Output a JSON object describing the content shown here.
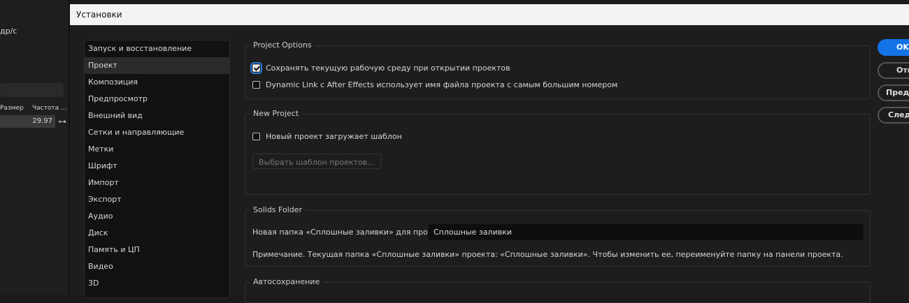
{
  "background_panel": {
    "fps_label": "дp/с",
    "columns": [
      "Размер",
      "Частота ..."
    ],
    "row_value": "29.97"
  },
  "dialog": {
    "title": "Установки",
    "sidebar": [
      "Запуск и восстановление",
      "Проект",
      "Композиция",
      "Предпросмотр",
      "Внешний вид",
      "Сетки и направляющие",
      "Метки",
      "Шрифт",
      "Импорт",
      "Экспорт",
      "Аудио",
      "Диск",
      "Память и ЦП",
      "Видео",
      "3D"
    ],
    "selected": "Проект",
    "project_options": {
      "title": "Project Options",
      "opt1": "Сохранять текущую рабочую среду при открытии проектов",
      "opt1_checked": true,
      "opt2": "Dynamic Link с After Effects использует имя файла проекта с самым большим номером",
      "opt2_checked": false
    },
    "new_project": {
      "title": "New Project",
      "opt": "Новый проект загружает шаблон",
      "opt_checked": false,
      "choose_button": "Выбрать шаблон проектов..."
    },
    "solids": {
      "title": "Solids Folder",
      "label": "Новая папка «Сплошные заливки» для проекта",
      "value": "Сплошные заливки",
      "note": "Примечание. Текущая папка «Сплошные заливки» проекта: «Сплошные заливки». Чтобы изменить ее, переименуйте папку на панели проекта."
    },
    "autosave": {
      "title": "Автосохранение"
    },
    "buttons": [
      "OK",
      "Отмена",
      "Предыдущий",
      "Следующий"
    ]
  }
}
